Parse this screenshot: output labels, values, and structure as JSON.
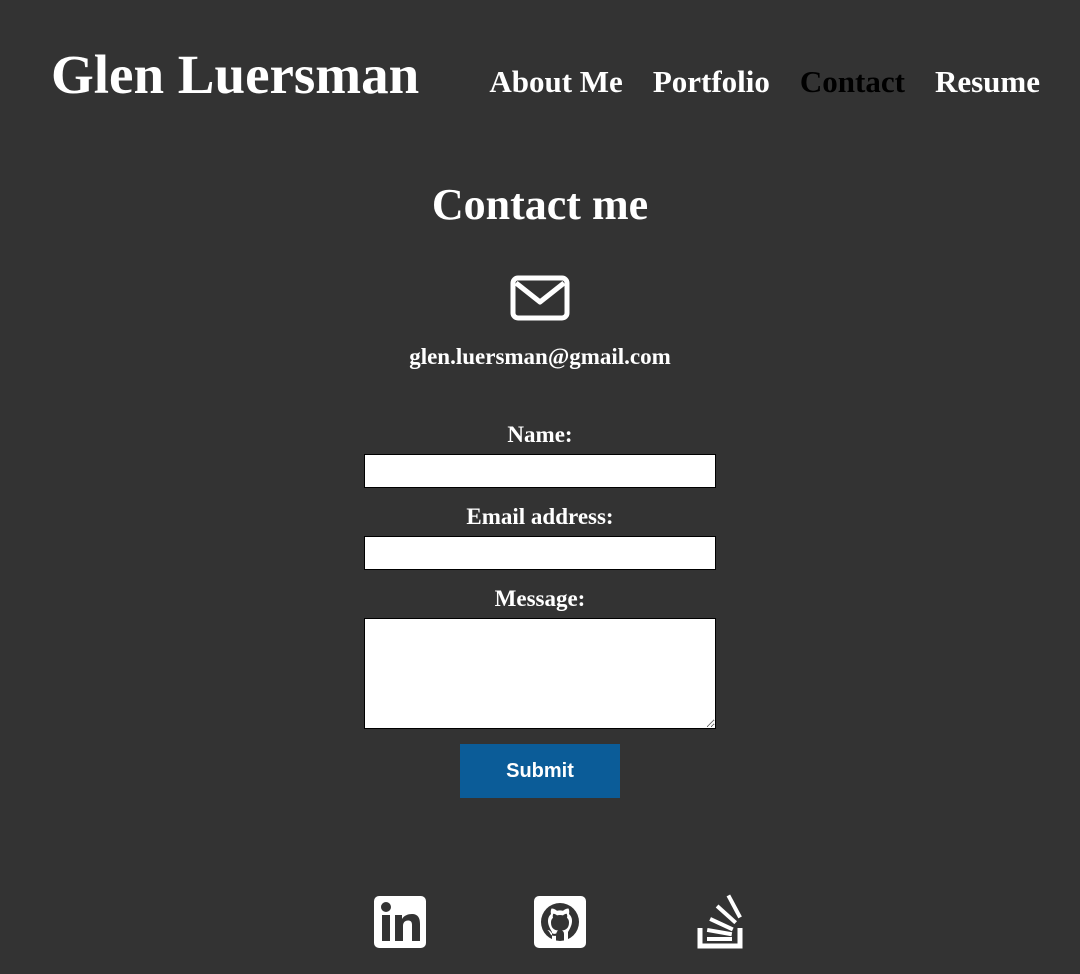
{
  "header": {
    "title": "Glen Luersman",
    "nav": [
      {
        "label": "About Me",
        "active": false
      },
      {
        "label": "Portfolio",
        "active": false
      },
      {
        "label": "Contact",
        "active": true
      },
      {
        "label": "Resume",
        "active": false
      }
    ]
  },
  "contact": {
    "heading": "Contact me",
    "icon": "envelope-icon",
    "email": "glen.luersman@gmail.com"
  },
  "form": {
    "name_label": "Name:",
    "name_value": "",
    "email_label": "Email address:",
    "email_value": "",
    "message_label": "Message:",
    "message_value": "",
    "submit_label": "Submit"
  },
  "social": [
    {
      "icon": "linkedin-icon"
    },
    {
      "icon": "github-icon"
    },
    {
      "icon": "stackoverflow-icon"
    }
  ],
  "colors": {
    "background": "#333333",
    "text": "#ffffff",
    "active_nav": "#000000",
    "button": "#0b5c98"
  }
}
